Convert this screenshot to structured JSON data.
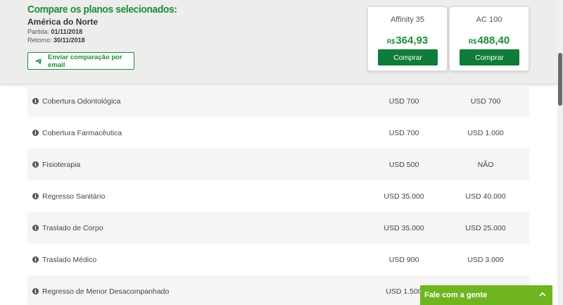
{
  "header": {
    "title": "Compare os planos selecionados:",
    "region": "América do Norte",
    "departure_label": "Partida:",
    "departure_date": "01/11/2018",
    "return_label": "Retorno:",
    "return_date": "30/11/2018",
    "email_button": "Enviar comparação por email",
    "email_icon": "paper-plane-icon"
  },
  "plans": [
    {
      "name": "Affinity 35",
      "currency": "R$",
      "price": "364,93",
      "buy_label": "Comprar"
    },
    {
      "name": "AC 100",
      "currency": "R$",
      "price": "488,40",
      "buy_label": "Comprar"
    }
  ],
  "coverage_rows": [
    {
      "label": "Cobertura Odontológica",
      "plan1": "USD 700",
      "plan2": "USD 700"
    },
    {
      "label": "Cobertura Farmacêutica",
      "plan1": "USD 700",
      "plan2": "USD 1.000"
    },
    {
      "label": "Fisioterapia",
      "plan1": "USD 500",
      "plan2": "NÃO"
    },
    {
      "label": "Regresso Sanitário",
      "plan1": "USD 35.000",
      "plan2": "USD 40.000"
    },
    {
      "label": "Traslado de Corpo",
      "plan1": "USD 35.000",
      "plan2": "USD 25.000"
    },
    {
      "label": "Traslado Médico",
      "plan1": "USD 900",
      "plan2": "USD 3.000"
    },
    {
      "label": "Regresso de Menor Desacompanhado",
      "plan1": "USD 1.500",
      "plan2": ""
    }
  ],
  "info_icon_glyph": "i",
  "chat": {
    "label": "Fale com a gente",
    "icon": "chevron-up-icon"
  },
  "colors": {
    "brand_green": "#1e8c3a",
    "button_green": "#107c39",
    "chat_green": "#6fb51f"
  }
}
